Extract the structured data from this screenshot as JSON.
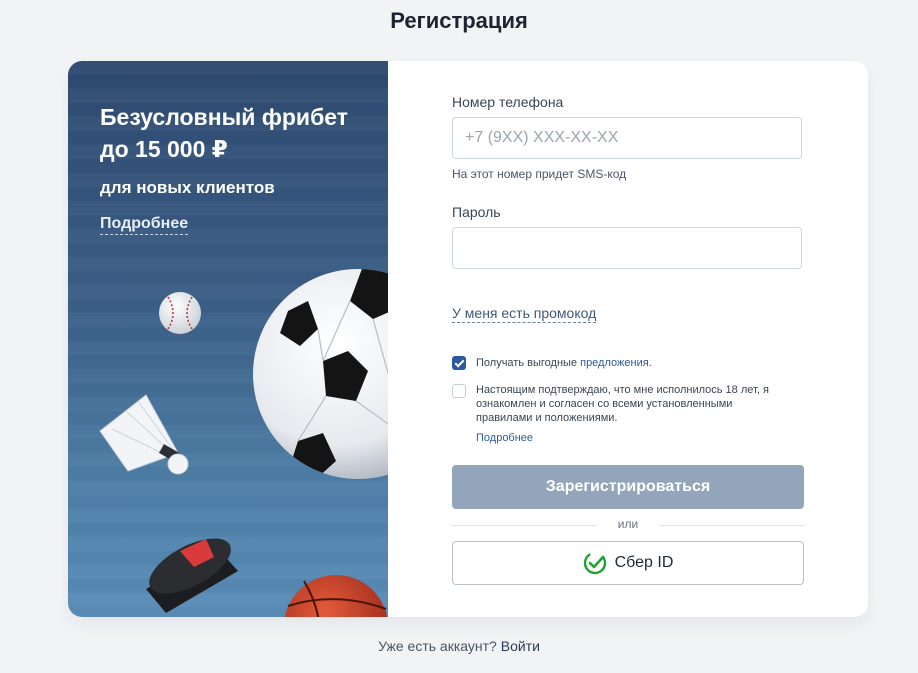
{
  "page": {
    "title": "Регистрация"
  },
  "promo": {
    "title": "Безусловный фрибет до 15 000 ₽",
    "subtitle": "для новых клиентов",
    "more_link": "Подробнее"
  },
  "form": {
    "phone": {
      "label": "Номер телефона",
      "placeholder": "+7 (9XX) XXX-XX-XX",
      "value": "",
      "hint": "На этот номер придет SMS-код"
    },
    "password": {
      "label": "Пароль",
      "value": ""
    },
    "promo_code_link": "У меня есть промокод",
    "offers_checkbox": {
      "checked": true,
      "text_before": "Получать выгодные ",
      "link": "предложения",
      "text_after": "."
    },
    "terms_checkbox": {
      "checked": false,
      "text": "Настоящим подтверждаю, что мне исполнилось 18 лет, я ознакомлен и согласен со всеми установленными правилами и положениями.",
      "more_link": "Подробнее"
    },
    "register_button": "Зарегистрироваться",
    "divider_text": "или",
    "sber_button": "Сбер ID"
  },
  "footer": {
    "text": "Уже есть аккаунт?",
    "login_link": "Войти"
  },
  "colors": {
    "accent": "#2b5aa0",
    "register_disabled": "#93a5ba",
    "promo_bg_top": "#2f4a70",
    "promo_bg_bottom": "#5a8db8",
    "sber_green": "#21a038"
  }
}
